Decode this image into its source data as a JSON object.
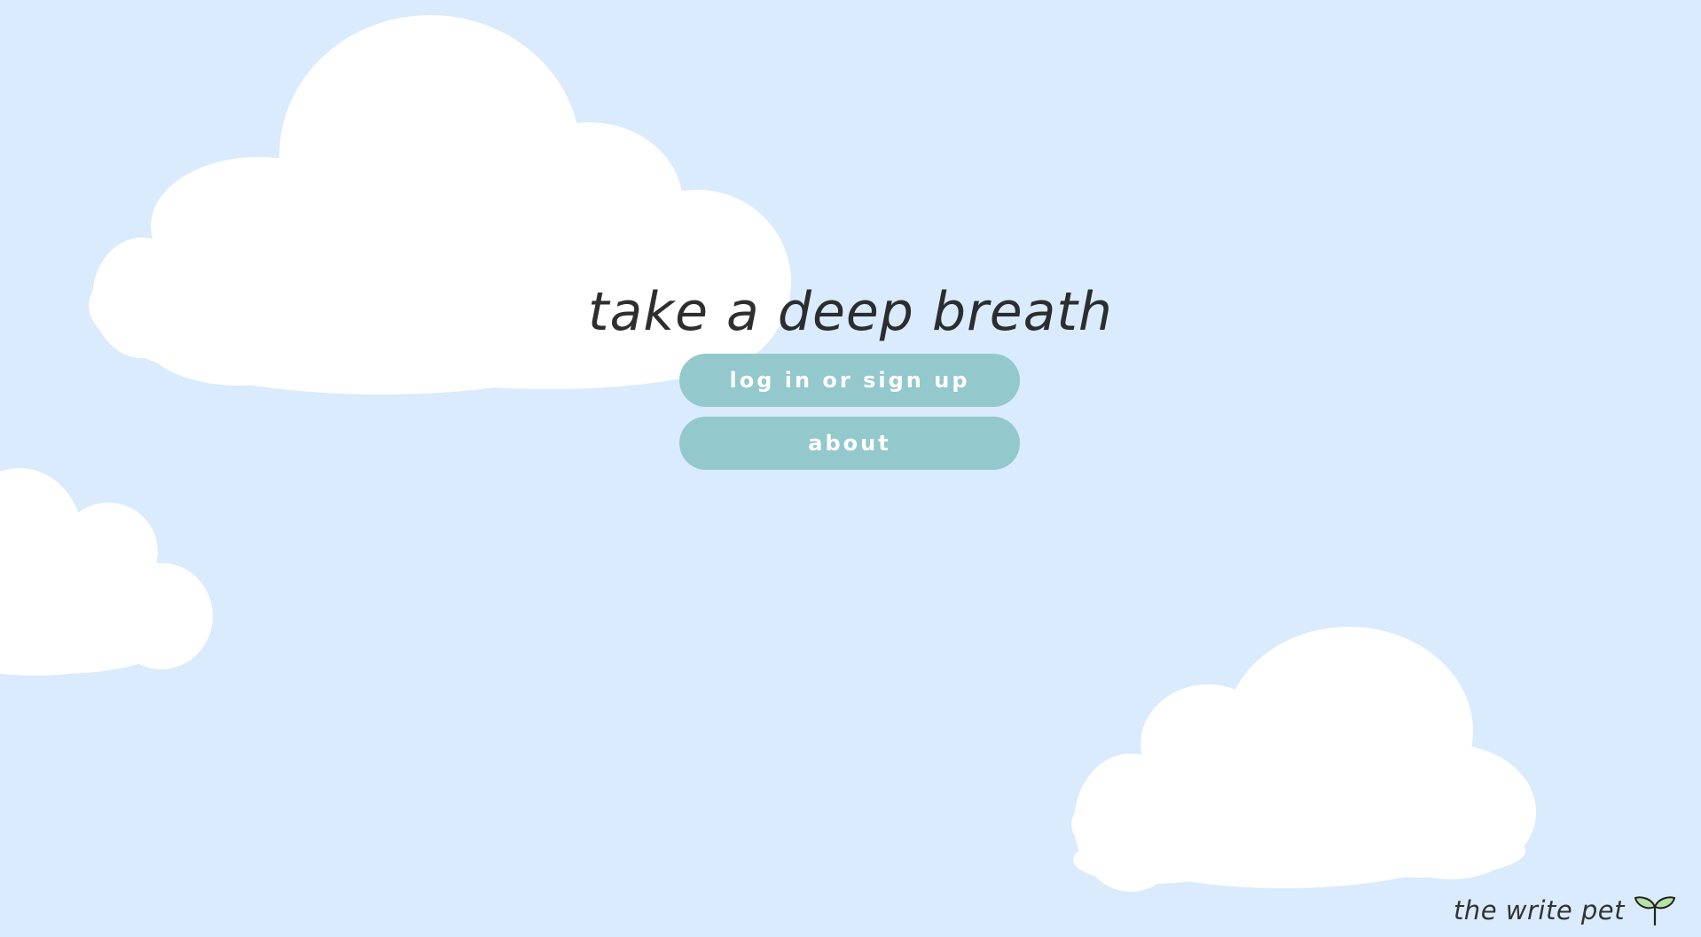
{
  "hero": {
    "tagline": "take a deep breath"
  },
  "actions": {
    "login_label": "log in or sign up",
    "about_label": "about"
  },
  "brand": {
    "name": "the write pet",
    "icon": "sprout-icon"
  },
  "colors": {
    "sky": "#d9ebfc",
    "cloud": "#ffffff",
    "button": "#93c8cc",
    "button_text": "#ffffff",
    "sprout_leaf": "#b8e2a4"
  }
}
